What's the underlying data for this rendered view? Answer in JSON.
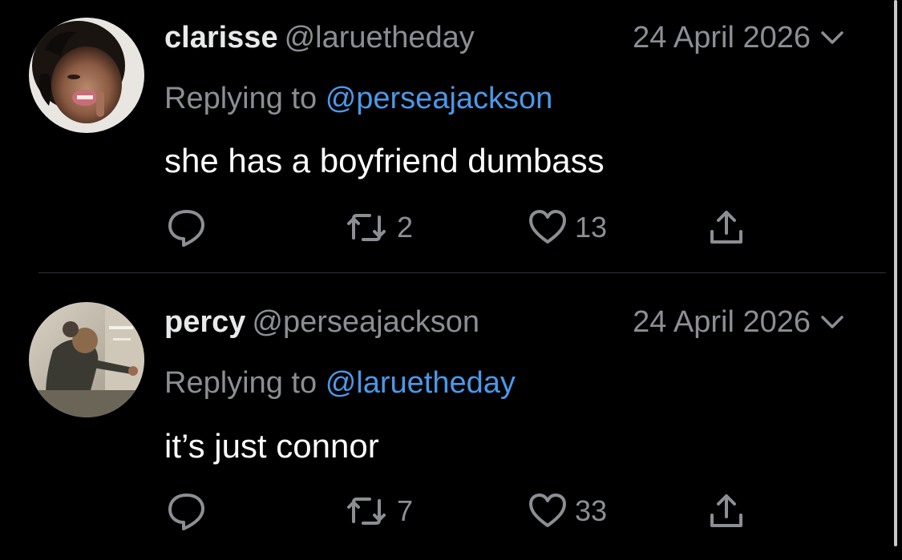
{
  "tweets": [
    {
      "name": "clarisse",
      "handle": "@laruetheday",
      "date": "24 April 2026",
      "replying_prefix": "Replying to",
      "replying_to": "@perseajackson",
      "text": "she has a boyfriend dumbass",
      "retweets": "2",
      "likes": "13"
    },
    {
      "name": "percy",
      "handle": "@perseajackson",
      "date": "24 April 2026",
      "replying_prefix": "Replying to",
      "replying_to": "@laruetheday",
      "text": "it’s just connor",
      "retweets": "7",
      "likes": "33"
    }
  ],
  "colors": {
    "background": "#000000",
    "text": "#ffffff",
    "muted": "#8b8f94",
    "link": "#4b98e8",
    "divider": "#2f3336"
  },
  "icons": [
    "reply-icon",
    "retweet-icon",
    "like-icon",
    "share-icon",
    "chevron-down-icon"
  ]
}
